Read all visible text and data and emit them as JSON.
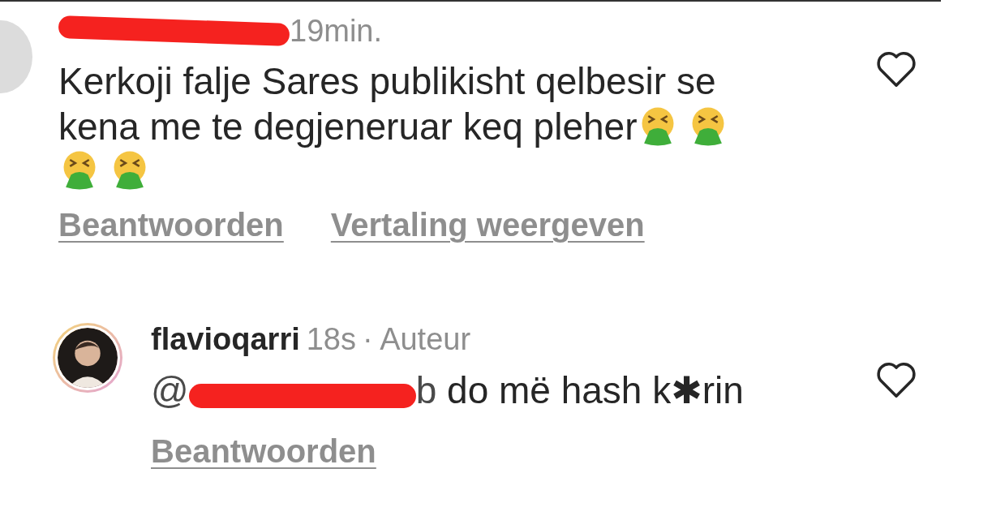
{
  "comments": [
    {
      "avatar": {
        "kind": "placeholder"
      },
      "author": {
        "redacted": true
      },
      "time": "19min.",
      "body": [
        {
          "kind": "text",
          "text": "Kerkoji falje Sares publikisht qelbesir se"
        },
        {
          "kind": "text",
          "text": "kena me te degjeneruar keq pleher"
        },
        {
          "kind": "emoji"
        },
        {
          "kind": "emoji"
        },
        {
          "kind": "emoji"
        },
        {
          "kind": "emoji"
        }
      ],
      "actions": [
        "Beantwoorden",
        "Vertaling weergeven"
      ],
      "liked": false
    },
    {
      "avatar": {
        "kind": "picture",
        "story_ring": true
      },
      "author": {
        "redacted": false,
        "name": "flavioqarri"
      },
      "time": "18s",
      "badge": "· Auteur",
      "body": [
        {
          "kind": "mention",
          "prefix": "@",
          "suffix": "b",
          "redacted": true
        },
        {
          "kind": "text",
          "text": " do më hash k✱rin"
        }
      ],
      "actions": [
        "Beantwoorden"
      ],
      "liked": false
    }
  ]
}
